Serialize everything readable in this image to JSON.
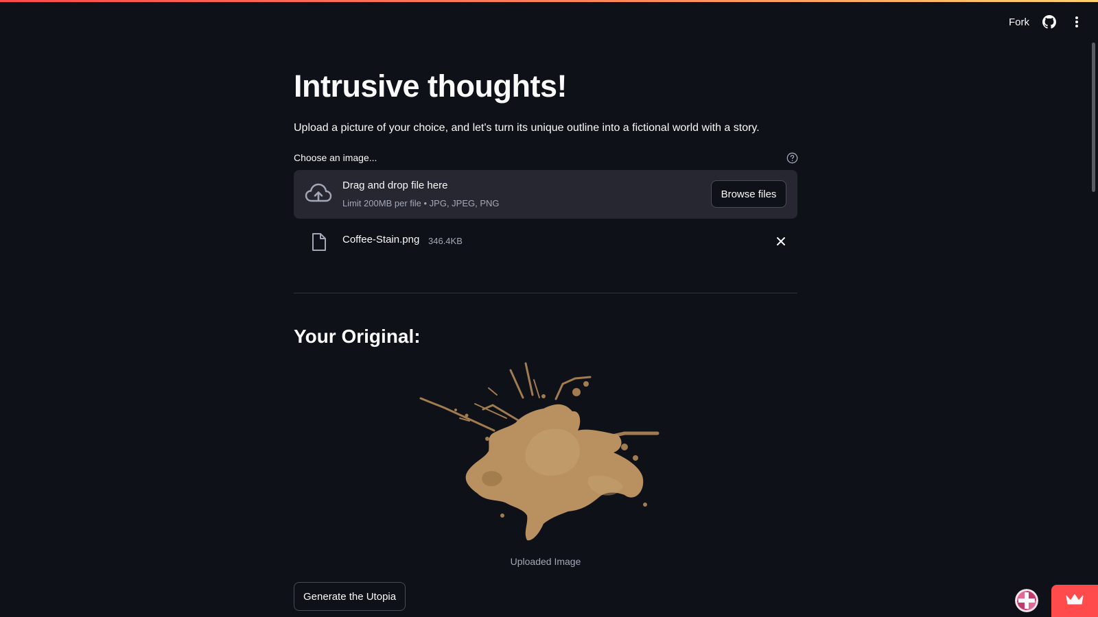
{
  "header": {
    "fork_label": "Fork",
    "icons": [
      "github-icon",
      "more-vertical-icon"
    ]
  },
  "main": {
    "title": "Intrusive thoughts!",
    "description": "Upload a picture of your choice, and let's turn its unique outline into a fictional world with a story.",
    "uploader": {
      "label": "Choose an image...",
      "drop_text": "Drag and drop file here",
      "limit_text": "Limit 200MB per file • JPG, JPEG, PNG",
      "browse_label": "Browse files"
    },
    "uploaded_file": {
      "name": "Coffee-Stain.png",
      "size": "346.4KB"
    },
    "subheader": "Your Original:",
    "image_caption": "Uploaded Image",
    "generate_label": "Generate the Utopia"
  },
  "colors": {
    "background": "#0e1117",
    "panel": "#262730",
    "accent": "#ff4b4b",
    "stain": "#b9905f"
  }
}
